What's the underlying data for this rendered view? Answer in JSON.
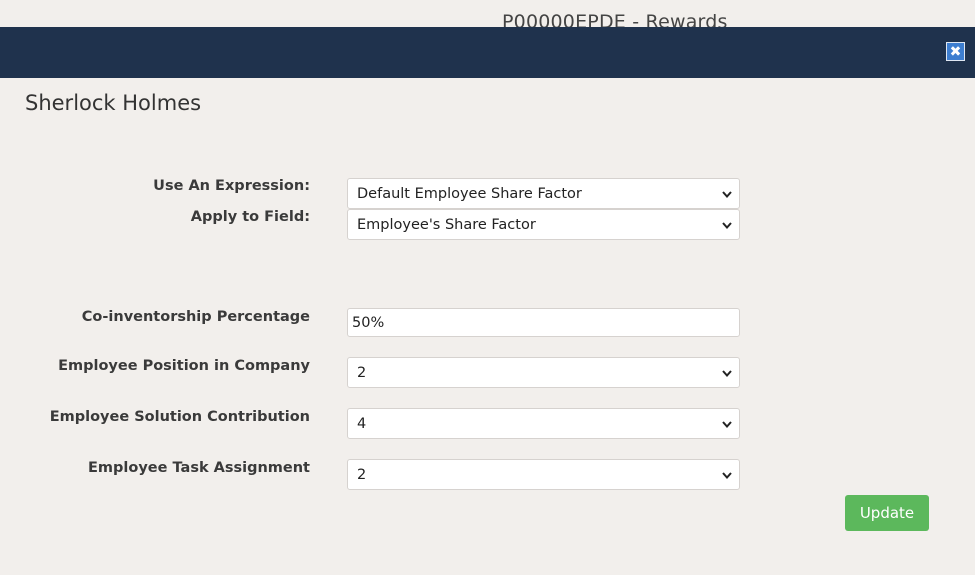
{
  "background_page": {
    "title": "P00000EPDE - Rewards"
  },
  "modal": {
    "close_icon": "close-icon",
    "person_name": "Sherlock Holmes",
    "fields": {
      "expression": {
        "label": "Use An Expression:",
        "value": "Default Employee Share Factor"
      },
      "apply_to": {
        "label": "Apply to Field:",
        "value": "Employee's Share Factor"
      },
      "co_inventorship": {
        "label": "Co-inventorship Percentage",
        "value": "50%"
      },
      "position": {
        "label": "Employee Position in Company",
        "value": "2"
      },
      "solution_contribution": {
        "label": "Employee Solution Contribution",
        "value": "4"
      },
      "task_assignment": {
        "label": "Employee Task Assignment",
        "value": "2"
      }
    },
    "update_label": "Update"
  },
  "colors": {
    "header": "#1f324d",
    "background": "#f2efec",
    "close_button": "#3d7ed0",
    "update_button": "#5cb85c"
  }
}
